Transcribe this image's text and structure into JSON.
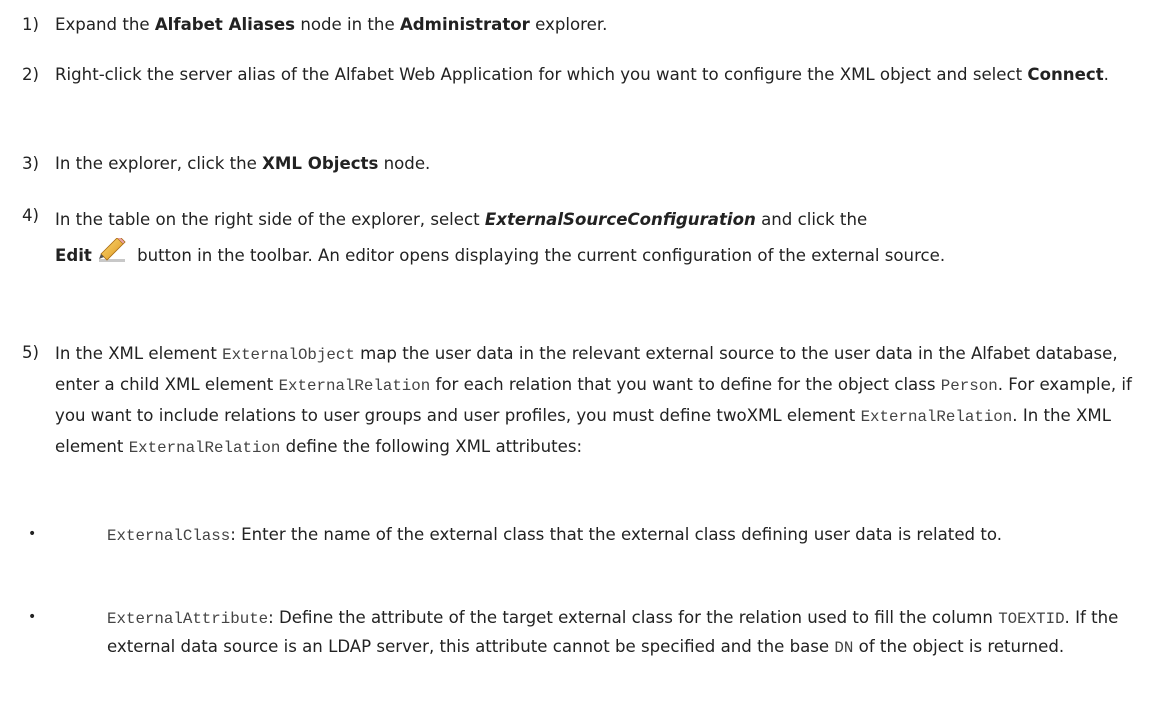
{
  "steps": [
    {
      "num": "1)",
      "t1": "Expand the ",
      "b1": "Alfabet Aliases",
      "t2": " node in the ",
      "b2": "Administrator",
      "t3": " explorer."
    },
    {
      "num": "2)",
      "t1": "Right-click the server alias of the Alfabet Web Application for which you want to configure the XML object and select ",
      "b1": "Connect",
      "t2": "."
    },
    {
      "num": "3)",
      "t1": "In the explorer, click the ",
      "b1": "XML Objects",
      "t2": " node."
    },
    {
      "num": "4)",
      "t1": "In the table on the right side of the explorer, select ",
      "bi1": "ExternalSourceConfiguration",
      "t2": " and click the ",
      "b1": "Edit",
      "t3": " button in the toolbar. An editor opens displaying the current configuration of the external source.",
      "icon": "edit-pencil-icon"
    },
    {
      "num": "5)",
      "t1": "In the XML element ",
      "c1": "ExternalObject",
      "t2": " map the user data in the relevant external source to the user data in the Alfabet database, enter a child XML element ",
      "c2": "ExternalRelation",
      "t3": " for each relation that you want to define for the object class ",
      "c3": "Person",
      "t4": ". For example, if you want to include relations to user groups and user profiles, you must define twoXML element ",
      "c4": "ExternalRelation",
      "t5": ". In the XML element ",
      "c5": "ExternalRelation",
      "t6": " define the following XML attributes:"
    }
  ],
  "bullets": [
    {
      "dot": "•",
      "c1": "ExternalClass",
      "t1": ": Enter the name of the external class that the external class defining user data is related to."
    },
    {
      "dot": "•",
      "c1": "ExternalAttribute",
      "t1": ": Define the attribute of the target external class for the relation used to fill the column ",
      "c2": "TOEXTID",
      "t2": ". If the external data source is an LDAP server, this attribute cannot be specified and the base ",
      "c3": "DN",
      "t3": " of the object is returned."
    }
  ]
}
